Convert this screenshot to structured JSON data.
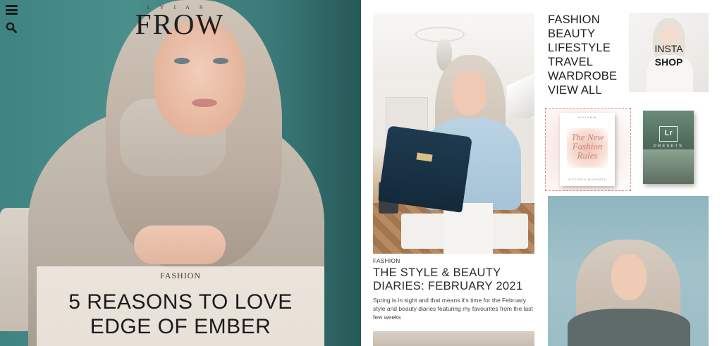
{
  "site": {
    "logo_small": "LYIAS",
    "logo_main": "FROW"
  },
  "header": {
    "menu_icon": "hamburger-menu-icon",
    "search_icon": "search-icon"
  },
  "hero": {
    "category": "FASHION",
    "title_line1": "5 REASONS TO LOVE",
    "title_line2": "EDGE OF EMBER"
  },
  "post": {
    "category": "FASHION",
    "title_line1": "THE STYLE & BEAUTY",
    "title_line2": "DIARIES: FEBRUARY 2021",
    "excerpt": "Spring is in sight and that means it's time for the February style and beauty diaries featuring my favourites from the last few weeks"
  },
  "sidebar": {
    "categories": [
      "FASHION",
      "BEAUTY",
      "LIFESTYLE",
      "TRAVEL",
      "WARDROBE",
      "VIEW ALL"
    ],
    "insta_line1": "INSTA",
    "insta_line2": "SHOP",
    "book": {
      "publisher": "VICTORIA",
      "title_line1": "The New",
      "title_line2": "Fashion",
      "title_line3": "Rules",
      "author": "VICTORIA MAGRATH"
    },
    "presets": {
      "badge": "Lr",
      "label": "PRESETS"
    }
  },
  "colors": {
    "hero_background": "#3f8482",
    "hero_card": "#f8f3ec",
    "text_dark": "#1f1f1f",
    "shop_border": "#d88f8f"
  }
}
